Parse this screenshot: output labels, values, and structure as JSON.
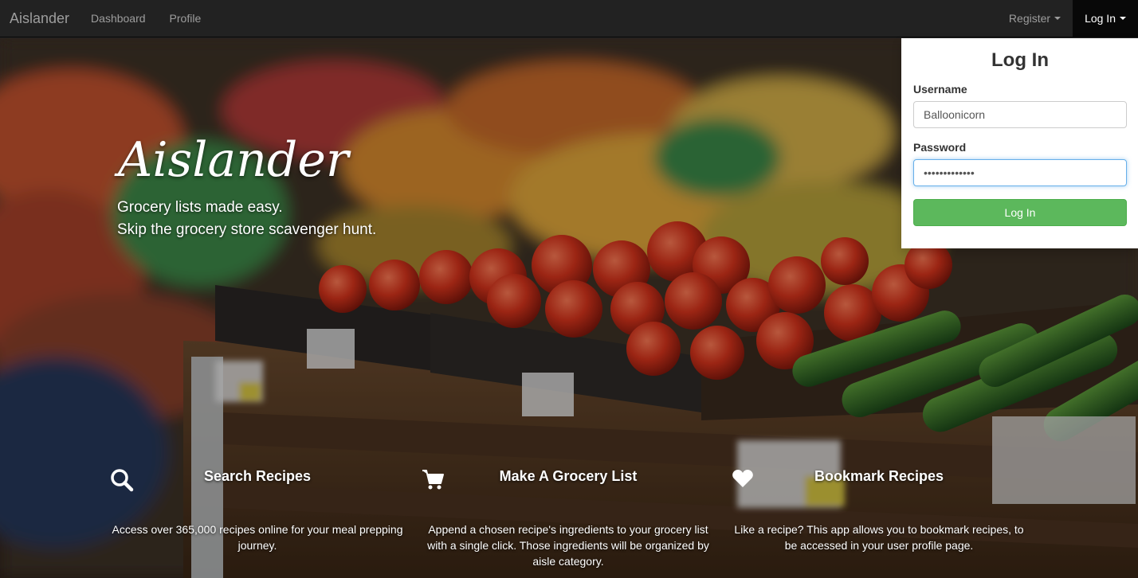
{
  "navbar": {
    "brand": "Aislander",
    "links": [
      "Dashboard",
      "Profile"
    ],
    "register_label": "Register",
    "login_label": "Log In"
  },
  "hero": {
    "title": "Aislander",
    "subtitle_lines": [
      "Grocery lists made easy.",
      "Skip the grocery store scavenger hunt."
    ]
  },
  "features": [
    {
      "title": "Search Recipes",
      "icon": "search-icon",
      "text": "Access over 365,000 recipes online for your meal prepping journey."
    },
    {
      "title": "Make A Grocery List",
      "icon": "shopping-cart-icon",
      "text": "Append a chosen recipe's ingredients to your grocery list with a single click. Those ingredients will be organized by aisle category."
    },
    {
      "title": "Bookmark Recipes",
      "icon": "heart-icon",
      "text": "Like a recipe? This app allows you to bookmark recipes, to be accessed in your user profile page."
    }
  ],
  "login_panel": {
    "title": "Log In",
    "username_label": "Username",
    "username_value": "Balloonicorn",
    "password_label": "Password",
    "password_value": "•••••••••••••",
    "submit_label": "Log In"
  },
  "colors": {
    "navbar_bg": "#222222",
    "login_button": "#5cb85c"
  }
}
